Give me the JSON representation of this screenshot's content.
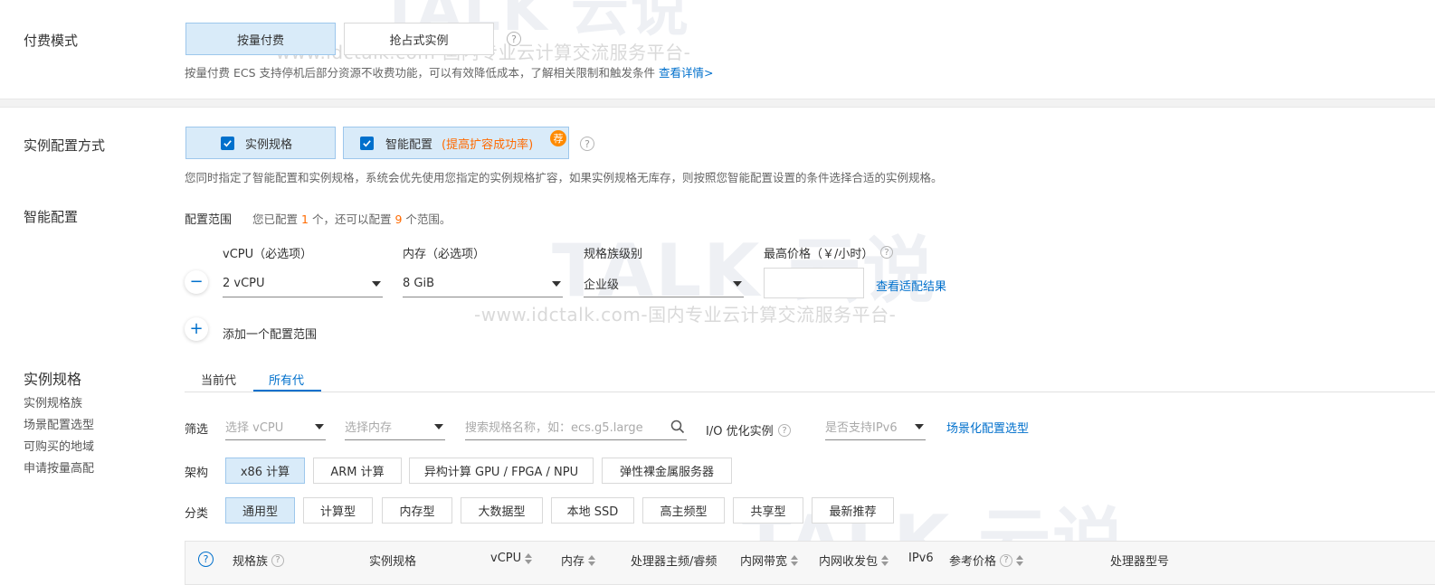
{
  "billing": {
    "label": "付费模式",
    "options": [
      "按量付费",
      "抢占式实例"
    ],
    "hint_prefix": "按量付费 ECS 支持停机后部分资源不收费功能，可以有效降低成本，了解相关限制和触发条件",
    "hint_link": "查看详情>"
  },
  "config_mode": {
    "label": "实例配置方式",
    "opt_spec": "实例规格",
    "opt_smart": "智能配置",
    "opt_smart_note": "(提高扩容成功率)",
    "recommend_badge": "荐",
    "hint": "您同时指定了智能配置和实例规格，系统会优先使用您指定的实例规格扩容，如果实例规格无库存，则按照您智能配置设置的条件选择合适的实例规格。"
  },
  "smart": {
    "label": "智能配置",
    "range_label": "配置范围",
    "range_text_1": "您已配置",
    "range_count_1": "1",
    "range_text_2": "个，还可以配置",
    "range_count_2": "9",
    "range_text_3": "个范围。",
    "vcpu_label": "vCPU（必选项）",
    "vcpu_value": "2 vCPU",
    "mem_label": "内存（必选项）",
    "mem_value": "8 GiB",
    "family_label": "规格族级别",
    "family_value": "企业级",
    "price_label": "最高价格（￥/小时）",
    "price_value": "",
    "view_result": "查看适配结果",
    "remove_symbol": "−",
    "add_symbol": "+",
    "add_label": "添加一个配置范围"
  },
  "spec": {
    "label": "实例规格",
    "side_links": [
      "实例规格族",
      "场景配置选型",
      "可购买的地域",
      "申请按量高配"
    ],
    "tabs": [
      "当前代",
      "所有代"
    ],
    "filter_label": "筛选",
    "filter_vcpu_placeholder": "选择 vCPU",
    "filter_mem_placeholder": "选择内存",
    "search_placeholder": "搜索规格名称，如：ecs.g5.large",
    "io_label": "I/O 优化实例",
    "ipv6_placeholder": "是否支持IPv6",
    "scene_link": "场景化配置选型",
    "arch_label": "架构",
    "arch_options": [
      "x86 计算",
      "ARM 计算",
      "异构计算 GPU / FPGA / NPU",
      "弹性裸金属服务器"
    ],
    "category_label": "分类",
    "category_options": [
      "通用型",
      "计算型",
      "内存型",
      "大数据型",
      "本地 SSD",
      "高主频型",
      "共享型",
      "最新推荐"
    ],
    "table_headers": [
      "规格族",
      "实例规格",
      "vCPU",
      "内存",
      "处理器主频/睿频",
      "内网带宽",
      "内网收发包",
      "IPv6",
      "参考价格",
      "处理器型号"
    ]
  },
  "watermark": {
    "brand": "TALK 云说",
    "sub": "-www.idctalk.com-国内专业云计算交流服务平台-"
  },
  "colors": {
    "accent": "#0070cc",
    "active_bg": "#d9ebf9",
    "orange": "#ff6a00"
  }
}
